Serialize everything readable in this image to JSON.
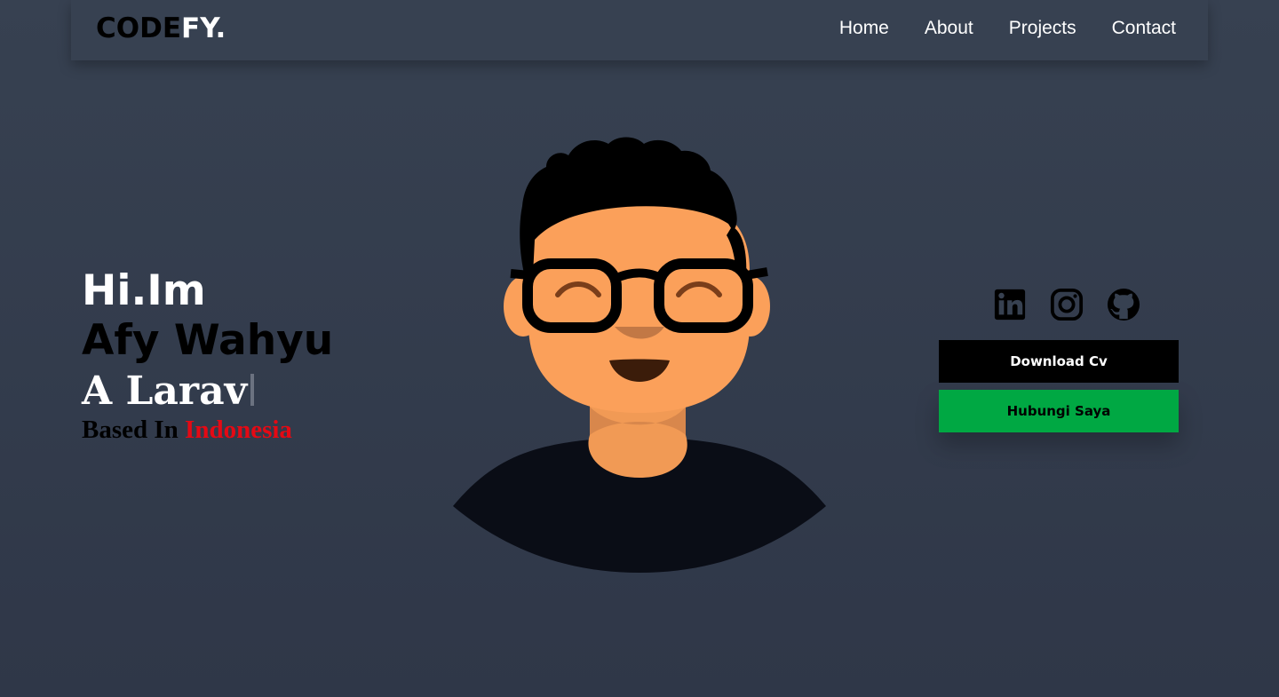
{
  "nav": {
    "logo_part1": "CODE",
    "logo_part2": "FY.",
    "links": [
      "Home",
      "About",
      "Projects",
      "Contact"
    ]
  },
  "hero": {
    "greeting": "Hi.Im",
    "name": "Afy Wahyu",
    "typed_text": "A Larav",
    "based_prefix": "Based In",
    "based_country": "Indonesia"
  },
  "social_icons": [
    "linkedin-icon",
    "instagram-icon",
    "github-icon"
  ],
  "buttons": {
    "download_cv": "Download Cv",
    "contact": "Hubungi Saya"
  },
  "colors": {
    "background": "#374151",
    "accent_red": "#e50914",
    "accent_green": "#00a843",
    "skin": "#fba05a"
  }
}
